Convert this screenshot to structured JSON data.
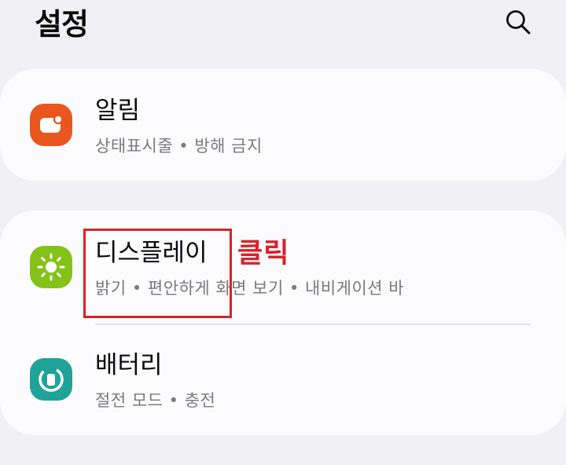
{
  "header": {
    "title": "설정",
    "search_icon": "search-icon"
  },
  "colors": {
    "background": "#f1f1f5",
    "card": "#fcfcfe",
    "notification_icon": "#e9561e",
    "display_icon": "#84c21a",
    "battery_icon": "#1fa398",
    "annotation": "#d8222b"
  },
  "cards": [
    {
      "items": [
        {
          "title": "알림",
          "subtitle": "상태표시줄 • 방해 금지",
          "icon": "notification-icon"
        }
      ]
    },
    {
      "items": [
        {
          "title": "디스플레이",
          "subtitle": "밝기 • 편안하게 화면 보기 • 내비게이션 바",
          "icon": "sun-icon"
        },
        {
          "title": "배터리",
          "subtitle": "절전 모드 • 충전",
          "icon": "battery-icon"
        }
      ]
    }
  ],
  "annotation": {
    "label": "클릭"
  }
}
